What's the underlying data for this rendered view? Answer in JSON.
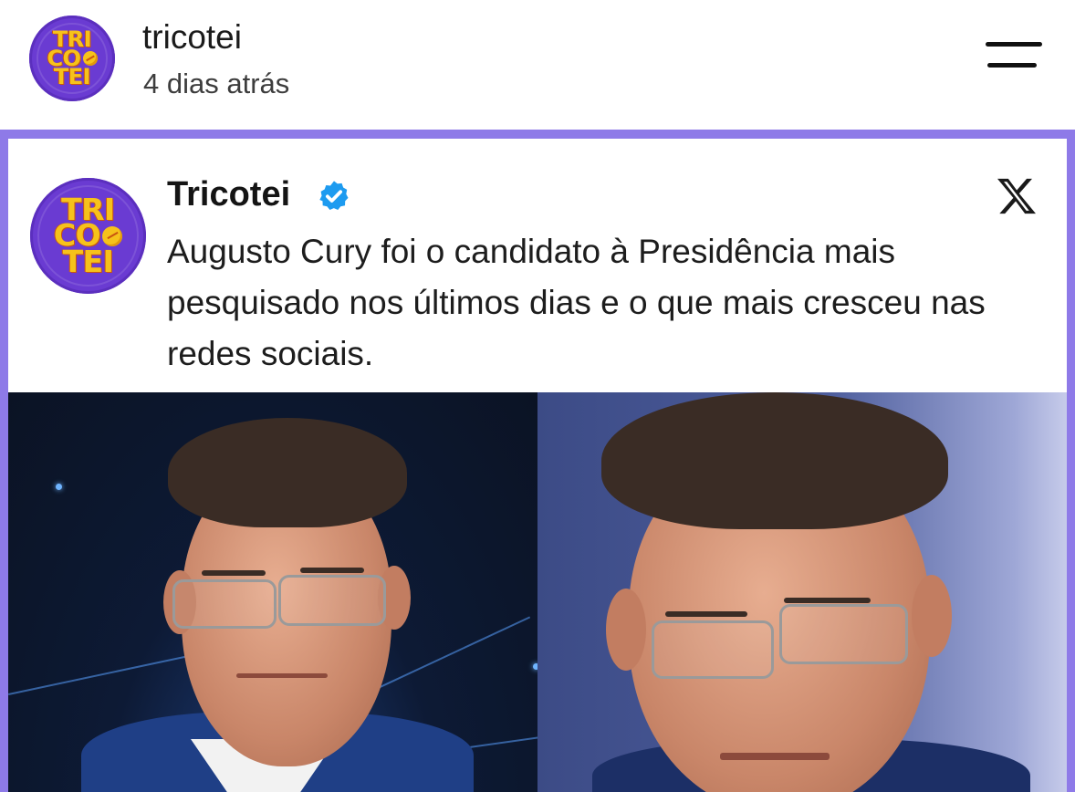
{
  "post": {
    "username": "tricotei",
    "timestamp": "4 dias atrás",
    "avatar_lines": [
      "TRI",
      "CO",
      "TEI"
    ]
  },
  "tweet": {
    "author": "Tricotei",
    "verified": true,
    "text": "Augusto Cury foi o candidato à Presidência mais pesquisado nos últimos dias e o que mais cresceu nas redes sociais.",
    "avatar_lines": [
      "TRI",
      "CO",
      "TEI"
    ],
    "platform_icon": "x-logo-icon"
  },
  "colors": {
    "card_border": "#8e7ae8",
    "avatar_bg": "#6a3bd2",
    "avatar_text": "#f6c21b",
    "verified_badge": "#1d9bf0"
  }
}
